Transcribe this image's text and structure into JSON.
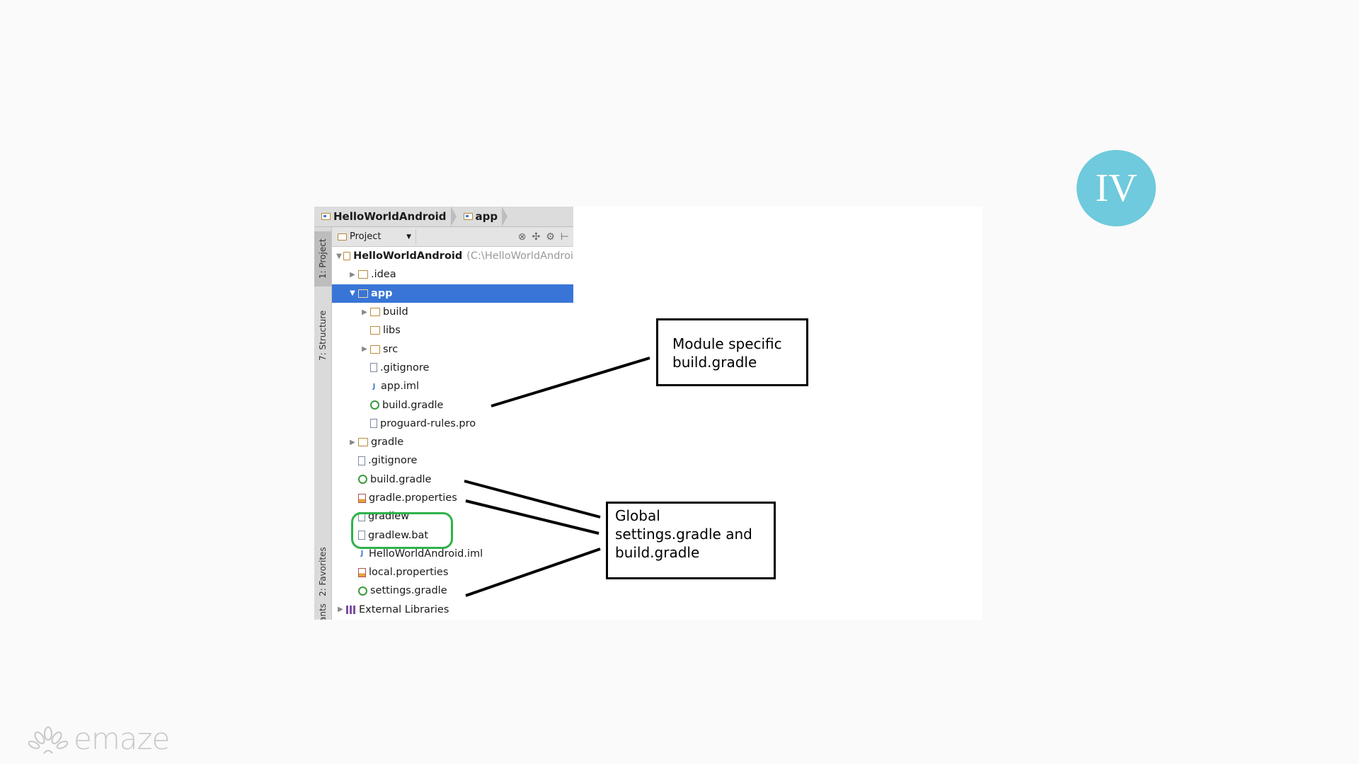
{
  "slide": {
    "badge": "IV",
    "logo": "emaze"
  },
  "ide": {
    "breadcrumb": [
      "HelloWorldAndroid",
      "app"
    ],
    "view_selector": "Project",
    "side_tabs": [
      "1: Project",
      "7: Structure",
      "2: Favorites",
      "ants"
    ],
    "tree": [
      {
        "label": "HelloWorldAndroid",
        "path": "(C:\\HelloWorldAndroi",
        "depth": 0,
        "arrow": "▼",
        "icon": "module"
      },
      {
        "label": ".idea",
        "depth": 1,
        "arrow": "▶",
        "icon": "folder"
      },
      {
        "label": "app",
        "depth": 1,
        "arrow": "▼",
        "icon": "module",
        "selected": true
      },
      {
        "label": "build",
        "depth": 2,
        "arrow": "▶",
        "icon": "folder"
      },
      {
        "label": "libs",
        "depth": 2,
        "arrow": "",
        "icon": "folder"
      },
      {
        "label": "src",
        "depth": 2,
        "arrow": "▶",
        "icon": "folder"
      },
      {
        "label": ".gitignore",
        "depth": 2,
        "arrow": "",
        "icon": "file"
      },
      {
        "label": "app.iml",
        "depth": 2,
        "arrow": "",
        "icon": "iml"
      },
      {
        "label": "build.gradle",
        "depth": 2,
        "arrow": "",
        "icon": "gradle"
      },
      {
        "label": "proguard-rules.pro",
        "depth": 2,
        "arrow": "",
        "icon": "file"
      },
      {
        "label": "gradle",
        "depth": 1,
        "arrow": "▶",
        "icon": "folder"
      },
      {
        "label": ".gitignore",
        "depth": 1,
        "arrow": "",
        "icon": "file"
      },
      {
        "label": "build.gradle",
        "depth": 1,
        "arrow": "",
        "icon": "gradle"
      },
      {
        "label": "gradle.properties",
        "depth": 1,
        "arrow": "",
        "icon": "props"
      },
      {
        "label": "gradlew",
        "depth": 1,
        "arrow": "",
        "icon": "file"
      },
      {
        "label": "gradlew.bat",
        "depth": 1,
        "arrow": "",
        "icon": "file"
      },
      {
        "label": "HelloWorldAndroid.iml",
        "depth": 1,
        "arrow": "",
        "icon": "iml"
      },
      {
        "label": "local.properties",
        "depth": 1,
        "arrow": "",
        "icon": "props"
      },
      {
        "label": "settings.gradle",
        "depth": 1,
        "arrow": "",
        "icon": "gradle"
      },
      {
        "label": "External Libraries",
        "depth": 0,
        "arrow": "▶",
        "icon": "libs"
      }
    ]
  },
  "annotations": {
    "module_callout": [
      "Module specific",
      "build.gradle"
    ],
    "global_callout": [
      "Global",
      "settings.gradle and",
      "build.gradle"
    ]
  },
  "colors": {
    "badge": "#6ecadc",
    "selection": "#3875d7",
    "highlight_ring": "#2fb24a"
  }
}
